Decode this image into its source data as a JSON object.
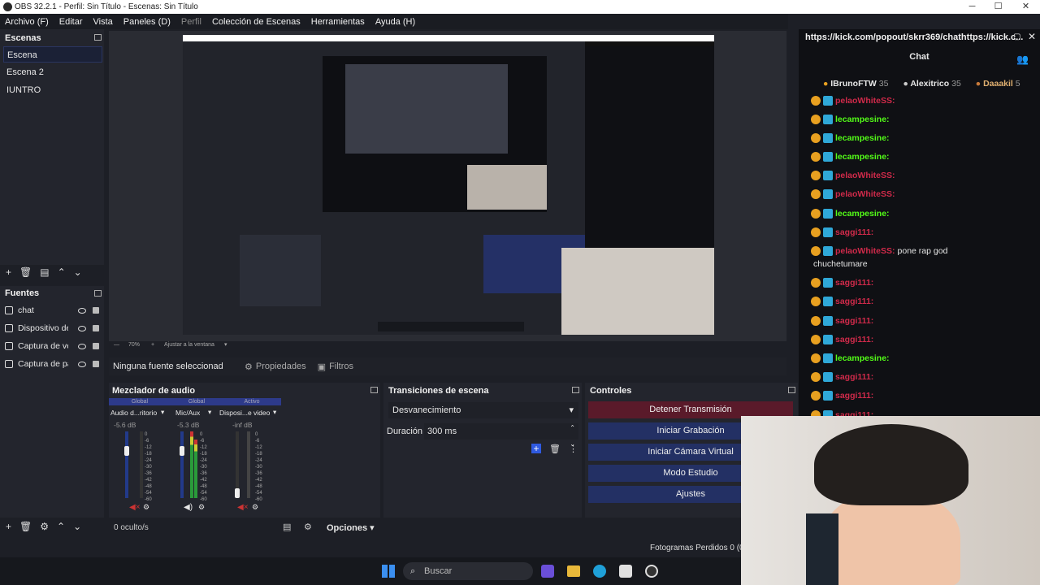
{
  "window": {
    "title": "OBS 32.2.1 - Perfil: Sin Título - Escenas: Sin Título"
  },
  "menu": [
    "Archivo (F)",
    "Editar",
    "Vista",
    "Paneles (D)",
    "Perfil",
    "Colección de Escenas",
    "Herramientas",
    "Ayuda (H)"
  ],
  "scenes": {
    "title": "Escenas",
    "items": [
      "Escena",
      "Escena 2",
      "IUNTRO"
    ]
  },
  "sources": {
    "title": "Fuentes",
    "items": [
      "chat",
      "Dispositivo de",
      "Captura de ve",
      "Captura de pa"
    ]
  },
  "preview": {
    "zoom": "70%",
    "fit": "Ajustar a la ventana"
  },
  "propbar": {
    "no_source": "Ninguna fuente seleccionad",
    "properties": "Propiedades",
    "filters": "Filtros"
  },
  "mixer": {
    "title": "Mezclador de audio",
    "tags": [
      "Global",
      "Global",
      "Activo"
    ],
    "channels": [
      {
        "name": "Audio d...ritorio",
        "db": "-5.6 dB"
      },
      {
        "name": "Mic/Aux",
        "db": "-5.3 dB"
      },
      {
        "name": "Disposi...e video",
        "db": "-inf dB"
      }
    ],
    "scale": [
      "0",
      "-6",
      "-12",
      "-18",
      "-24",
      "-30",
      "-36",
      "-42",
      "-48",
      "-54",
      "-60"
    ]
  },
  "transitions": {
    "title": "Transiciones de escena",
    "selected": "Desvanecimiento",
    "duration_label": "Duración",
    "duration_value": "300 ms"
  },
  "controls": {
    "title": "Controles",
    "buttons": [
      "Detener Transmisión",
      "Iniciar Grabación",
      "Iniciar Cámara Virtual",
      "Modo Estudio",
      "Ajustes"
    ]
  },
  "status": {
    "hidden": "0 oculto/s",
    "options": "Opciones",
    "dropped": "Fotogramas Perdidos 0 (0"
  },
  "taskbar": {
    "search": "Buscar"
  },
  "chat": {
    "url": "https://kick.com/popout/skrr369/chathttps://kick.c...",
    "title": "Chat",
    "top": [
      {
        "name": "IBrunoFTW",
        "n": "35"
      },
      {
        "name": "Alexitrico",
        "n": "35"
      },
      {
        "name": "Daaakil",
        "n": "5"
      }
    ],
    "messages": [
      {
        "nick": "pelaoWhiteSS:",
        "color": "r",
        "text": ""
      },
      {
        "nick": "lecampesine:",
        "color": "g",
        "text": ""
      },
      {
        "nick": "lecampesine:",
        "color": "g",
        "text": ""
      },
      {
        "nick": "lecampesine:",
        "color": "g",
        "text": ""
      },
      {
        "nick": "pelaoWhiteSS:",
        "color": "r",
        "text": ""
      },
      {
        "nick": "pelaoWhiteSS:",
        "color": "r",
        "text": ""
      },
      {
        "nick": "lecampesine:",
        "color": "g",
        "text": ""
      },
      {
        "nick": "saggi111:",
        "color": "r",
        "text": ""
      },
      {
        "nick": "pelaoWhiteSS:",
        "color": "r",
        "text": "pone rap god"
      },
      {
        "nick": "",
        "color": "n",
        "text": "chuchetumare"
      },
      {
        "nick": "saggi111:",
        "color": "r",
        "text": ""
      },
      {
        "nick": "saggi111:",
        "color": "r",
        "text": ""
      },
      {
        "nick": "saggi111:",
        "color": "r",
        "text": ""
      },
      {
        "nick": "saggi111:",
        "color": "r",
        "text": ""
      },
      {
        "nick": "lecampesine:",
        "color": "g",
        "text": ""
      },
      {
        "nick": "saggi111:",
        "color": "r",
        "text": ""
      },
      {
        "nick": "saggi111:",
        "color": "r",
        "text": ""
      },
      {
        "nick": "saggi111:",
        "color": "r",
        "text": ""
      }
    ]
  }
}
